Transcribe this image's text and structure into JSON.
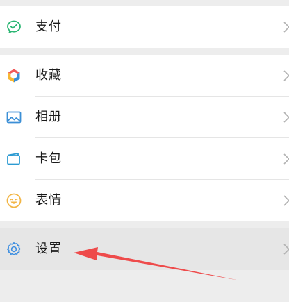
{
  "menu": {
    "groups": [
      {
        "items": [
          {
            "label": "支付",
            "icon": "wallet-check-icon"
          }
        ]
      },
      {
        "items": [
          {
            "label": "收藏",
            "icon": "cube-icon"
          },
          {
            "label": "相册",
            "icon": "photo-icon"
          },
          {
            "label": "卡包",
            "icon": "card-icon"
          },
          {
            "label": "表情",
            "icon": "smiley-icon"
          }
        ]
      },
      {
        "items": [
          {
            "label": "设置",
            "icon": "gear-icon",
            "selected": true
          }
        ]
      }
    ]
  },
  "colors": {
    "background": "#ededed",
    "row": "#ffffff",
    "selected_row": "#e6e6e6",
    "pay_icon": "#2bb673",
    "photo_icon": "#3b8fd6",
    "card_icon": "#2d9bd2",
    "smiley_icon": "#f2b544",
    "gear_icon": "#3f8fe0",
    "annotation_arrow": "#ee4b4b"
  }
}
